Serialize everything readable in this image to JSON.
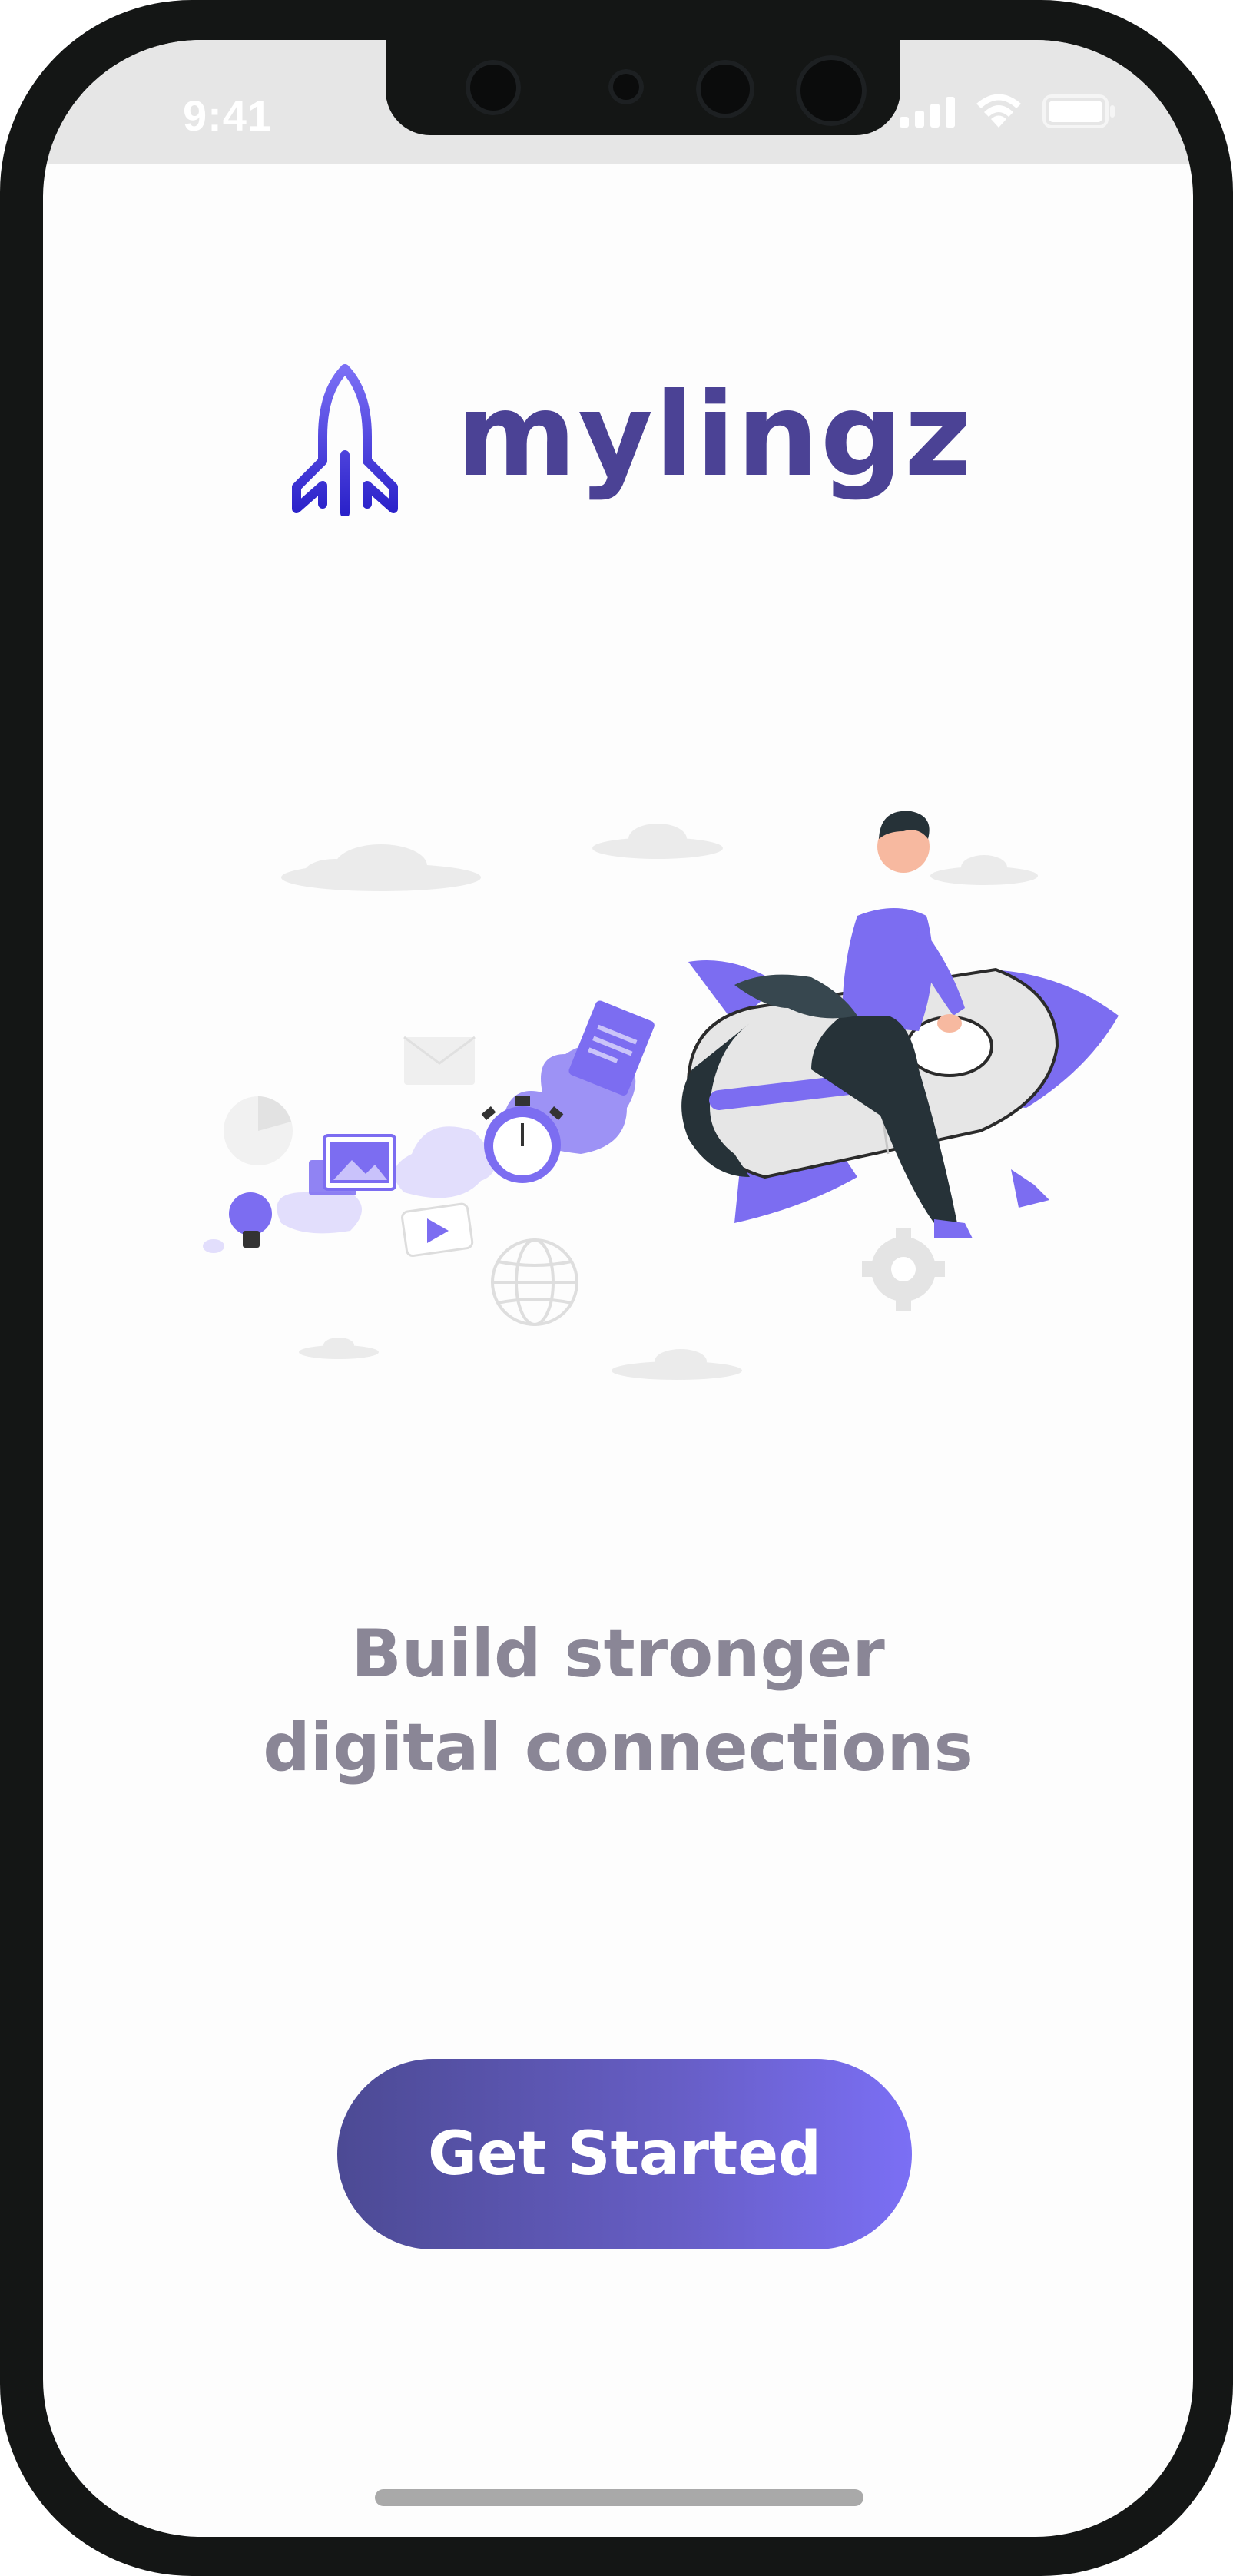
{
  "status_bar": {
    "time": "9:41",
    "icons": [
      "cellular-signal-icon",
      "wifi-icon",
      "battery-icon"
    ]
  },
  "app": {
    "brand_name": "mylingz",
    "logo_icon": "rocket-icon"
  },
  "illustration": {
    "subject": "person-riding-rocket-illustration",
    "icons": [
      "cloud-icon",
      "document-icon",
      "mail-icon",
      "pie-chart-icon",
      "image-icon",
      "stopwatch-icon",
      "lightbulb-icon",
      "play-video-icon",
      "globe-icon",
      "gear-icon"
    ]
  },
  "onboarding": {
    "tagline_line1": "Build stronger",
    "tagline_line2": "digital connections",
    "cta_label": "Get Started"
  },
  "colors": {
    "brand": "#4b4295",
    "accent": "#7b6ff5",
    "tagline": "#8a8696",
    "frame": "#141615"
  }
}
